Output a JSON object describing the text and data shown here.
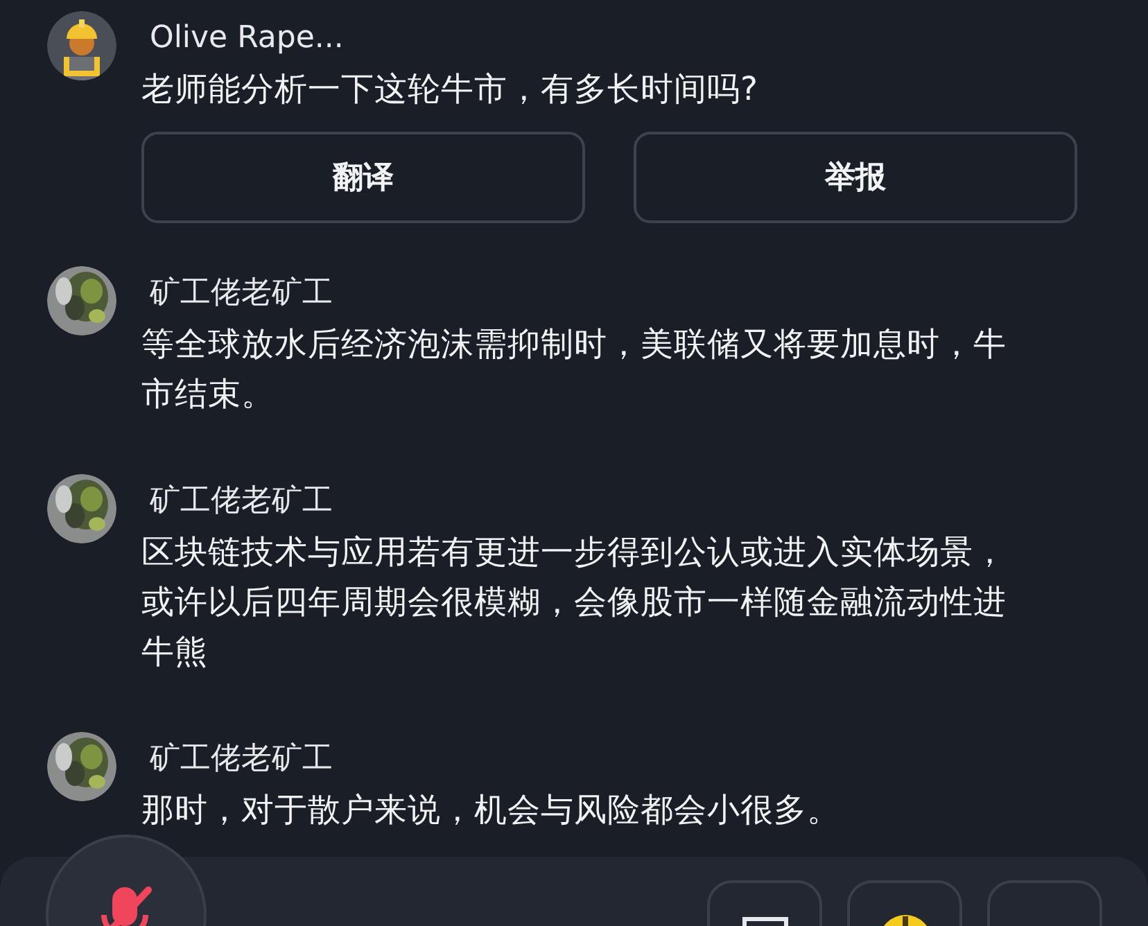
{
  "posts": [
    {
      "kind": "question",
      "name": "Olive Rape...",
      "lines": [
        "老师能分析一下这轮牛市，有多长时间吗?"
      ],
      "actions": [
        "翻译",
        "举报"
      ]
    },
    {
      "kind": "reply",
      "name": "矿工佬老矿工",
      "lines": [
        "等全球放水后经济泡沫需抑制时，美联储又将要加息时，牛",
        "市结束。"
      ]
    },
    {
      "kind": "reply",
      "name": "矿工佬老矿工",
      "lines": [
        "区块链技术与应用若有更进一步得到公认或进入实体场景，",
        "或许以后四年周期会很模糊，会像股市一样随金融流动性进",
        "牛熊"
      ]
    },
    {
      "kind": "reply",
      "name": "矿工佬老矿工",
      "lines": [
        "那时，对于散户来说，机会与风险都会小很多。"
      ]
    }
  ],
  "bottom_bar": {
    "mic_muted": true
  }
}
